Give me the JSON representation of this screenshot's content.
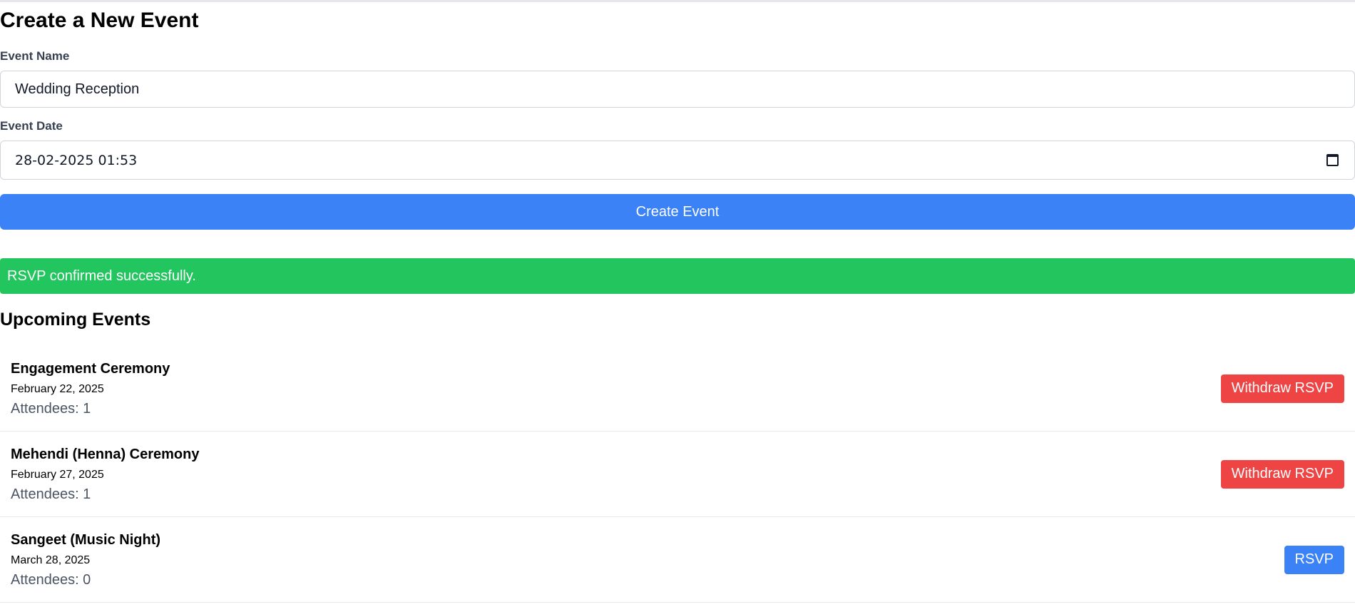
{
  "form": {
    "title": "Create a New Event",
    "name_label": "Event Name",
    "name_value": "Wedding Reception",
    "date_label": "Event Date",
    "date_value": "28-02-2025 01:53",
    "submit_label": "Create Event"
  },
  "alert": {
    "message": "RSVP confirmed successfully.",
    "color": "#22c55e"
  },
  "events_section": {
    "title": "Upcoming Events",
    "attendees_prefix": "Attendees: ",
    "events": [
      {
        "name": "Engagement Ceremony",
        "date": "February 22, 2025",
        "attendees": "Attendees: 1",
        "action_label": "Withdraw RSVP",
        "action_type": "withdraw"
      },
      {
        "name": "Mehendi (Henna) Ceremony",
        "date": "February 27, 2025",
        "attendees": "Attendees: 1",
        "action_label": "Withdraw RSVP",
        "action_type": "withdraw"
      },
      {
        "name": "Sangeet (Music Night)",
        "date": "March 28, 2025",
        "attendees": "Attendees: 0",
        "action_label": "RSVP",
        "action_type": "rsvp"
      }
    ]
  },
  "colors": {
    "primary": "#3b82f6",
    "danger": "#ef4444",
    "success": "#22c55e"
  },
  "icons": {
    "date_picker": "calendar-icon"
  }
}
